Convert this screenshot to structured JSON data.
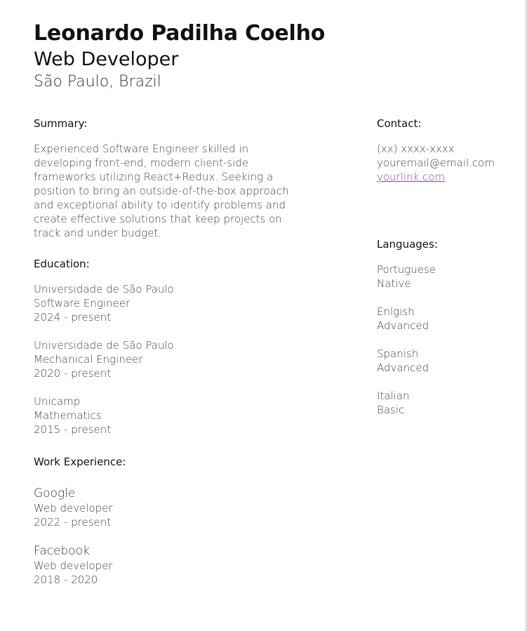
{
  "header": {
    "name": "Leonardo Padilha Coelho",
    "role": "Web Developer",
    "location": "São Paulo, Brazil"
  },
  "summary": {
    "title": "Summary:",
    "text": "Experienced Software Engineer skilled in developing front-end, modern client-side frameworks utilizing React+Redux. Seeking a position to bring an outside-of-the-box approach and exceptional ability to identify problems and create effective solutions that keep projects on track and under budget."
  },
  "contact": {
    "title": "Contact:",
    "phone": "(xx) xxxx-xxxx",
    "email": "youremail@email.com",
    "link": "yourlink.com"
  },
  "education": {
    "title": "Education:",
    "items": [
      {
        "school": "Universidade de São Paulo",
        "degree": "Software Engineer",
        "period": "2024 - present"
      },
      {
        "school": "Universidade de São Paulo",
        "degree": "Mechanical Engineer",
        "period": "2020 - present"
      },
      {
        "school": "Unicamp",
        "degree": "Mathematics",
        "period": "2015 - present"
      }
    ]
  },
  "languages": {
    "title": "Languages:",
    "items": [
      {
        "language": "Portuguese",
        "level": "Native"
      },
      {
        "language": "Enlgish",
        "level": "Advanced"
      },
      {
        "language": "Spanish",
        "level": "Advanced"
      },
      {
        "language": "Italian",
        "level": "Basic"
      }
    ]
  },
  "work": {
    "title": "Work Experience:",
    "items": [
      {
        "company": "Google",
        "position": "Web developer",
        "period": "2022 - present"
      },
      {
        "company": "Facebook",
        "position": "Web developer",
        "period": "2018 - 2020"
      }
    ]
  },
  "colors": {
    "link": "#7d4aa3",
    "heading": "#111111",
    "body": "#444444"
  }
}
